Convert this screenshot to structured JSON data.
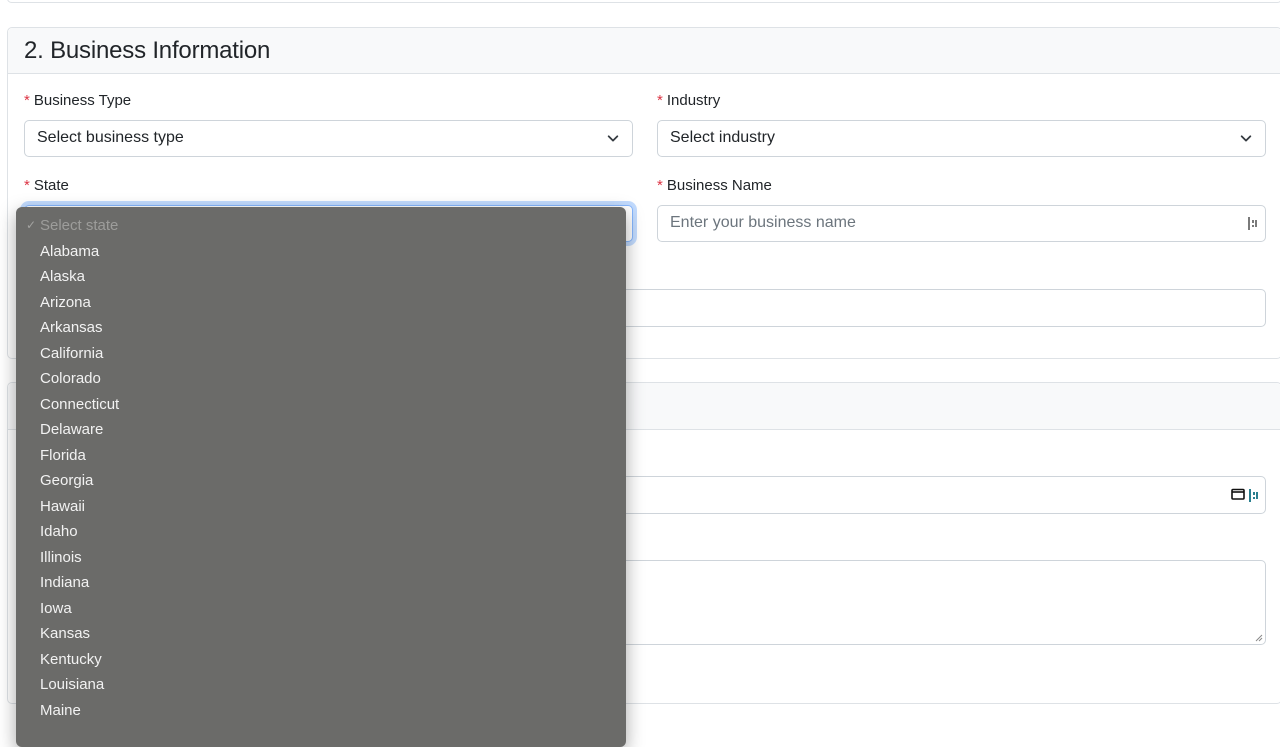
{
  "section": {
    "title": "2. Business Information"
  },
  "fields": {
    "business_type": {
      "label": "Business Type",
      "value": "Select business type"
    },
    "industry": {
      "label": "Industry",
      "value": "Select industry"
    },
    "state": {
      "label": "State"
    },
    "business_name": {
      "label": "Business Name",
      "placeholder": "Enter your business name"
    }
  },
  "required_marker": "*",
  "state_dropdown": {
    "selected_check": "✓",
    "items": [
      "Select state",
      "Alabama",
      "Alaska",
      "Arizona",
      "Arkansas",
      "California",
      "Colorado",
      "Connecticut",
      "Delaware",
      "Florida",
      "Georgia",
      "Hawaii",
      "Idaho",
      "Illinois",
      "Indiana",
      "Iowa",
      "Kansas",
      "Kentucky",
      "Louisiana",
      "Maine"
    ]
  },
  "icons": {
    "select_chevron": "chevron-down-icon",
    "autofill": "password-manager-icon",
    "calendar": "calendar-icon"
  },
  "colors": {
    "required": "#dc3545",
    "focus_border": "#86b7fe",
    "dropdown_bg": "#6b6b69"
  }
}
